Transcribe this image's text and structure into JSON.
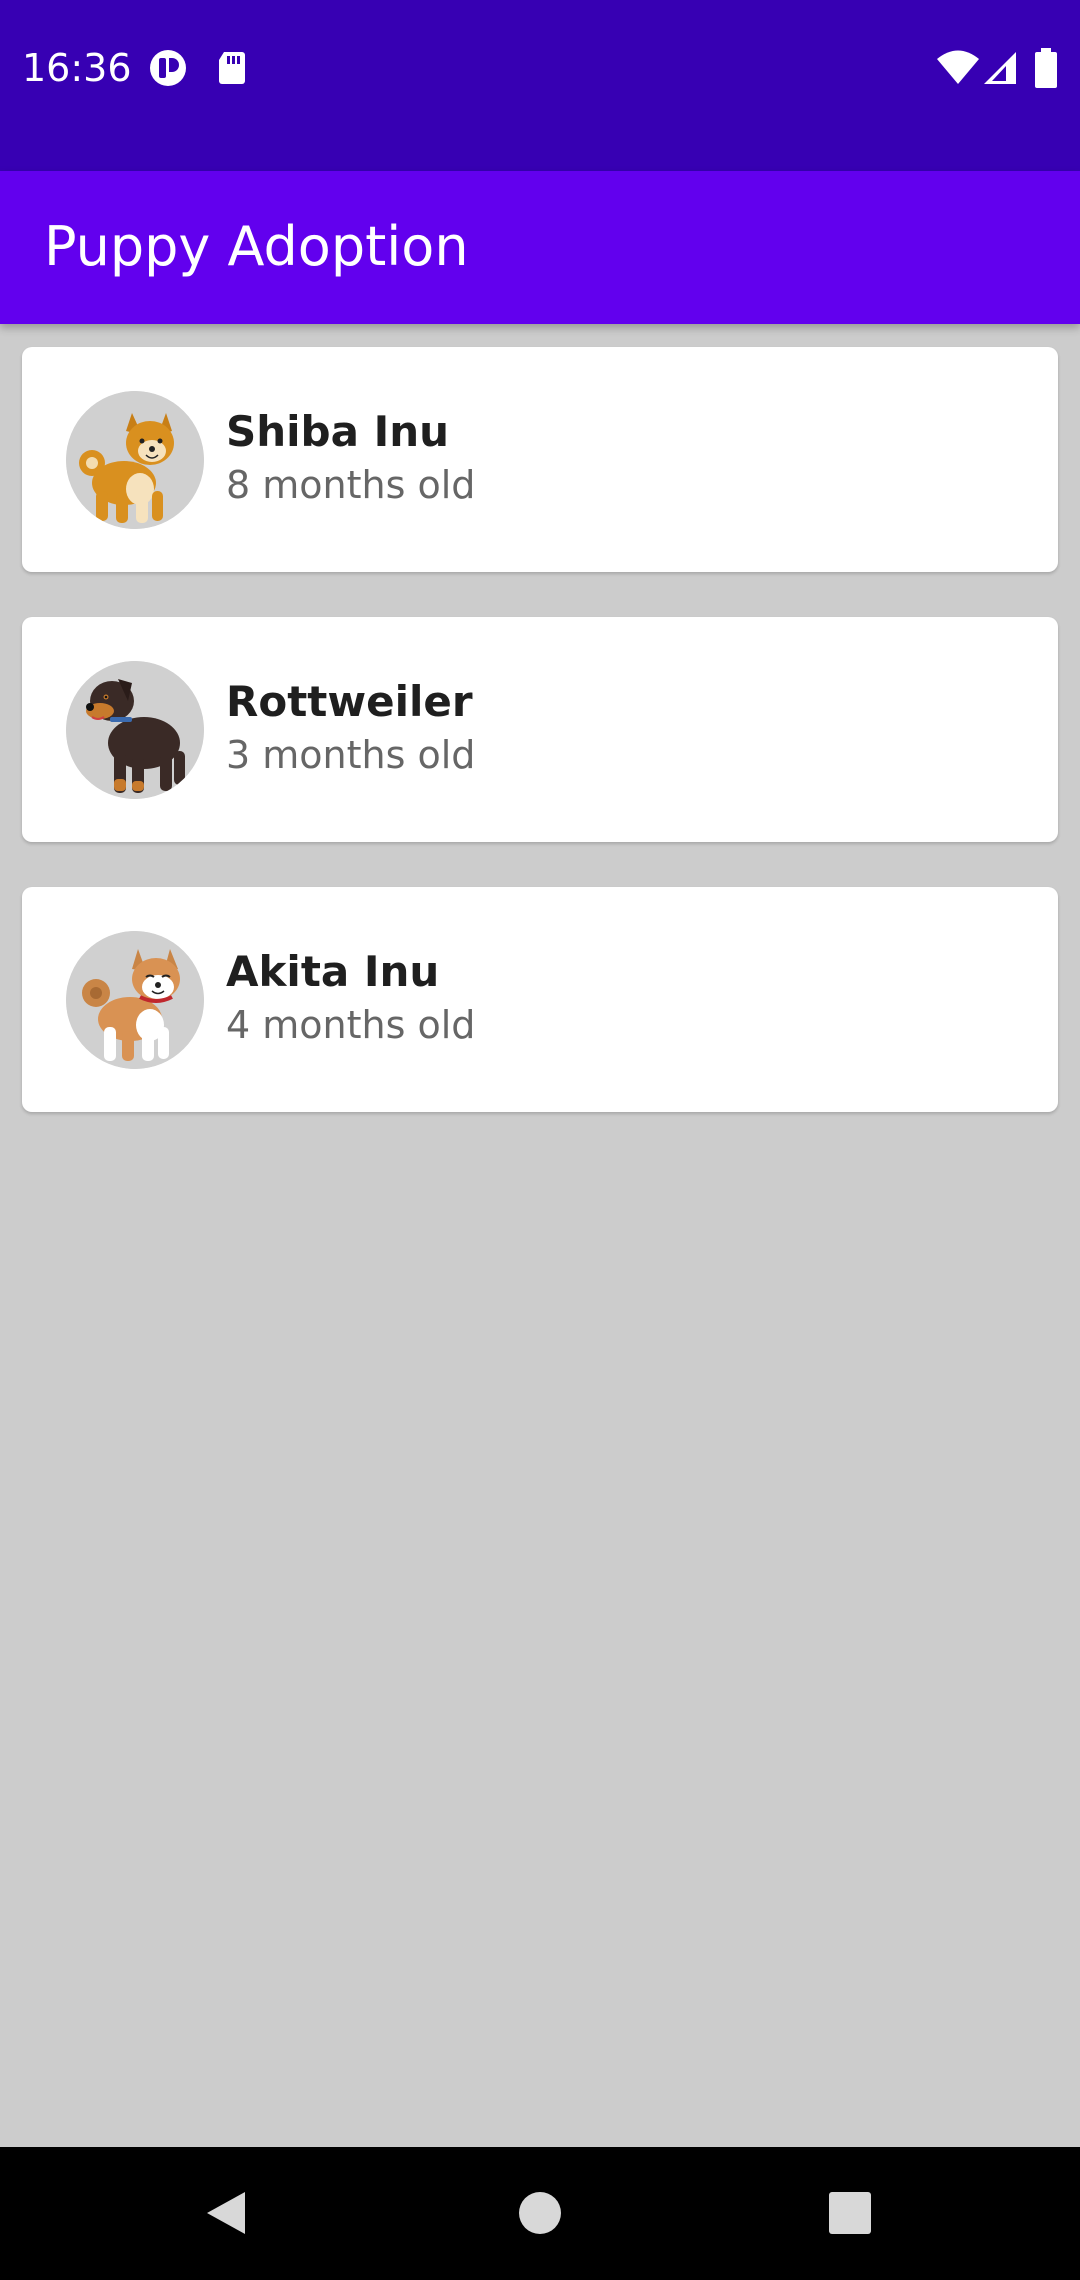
{
  "status_bar": {
    "time": "16:36",
    "left_icons": [
      "app-notification-icon",
      "sd-card-icon"
    ],
    "right_icons": [
      "wifi-icon",
      "cell-signal-icon",
      "battery-icon"
    ],
    "background": "#3700b3"
  },
  "app_bar": {
    "title": "Puppy Adoption",
    "background": "#6200ee"
  },
  "puppies": [
    {
      "name": "Shiba Inu",
      "age": "8 months old",
      "icon": "shiba-inu-icon"
    },
    {
      "name": "Rottweiler",
      "age": "3 months old",
      "icon": "rottweiler-icon"
    },
    {
      "name": "Akita Inu",
      "age": "4 months old",
      "icon": "akita-inu-icon"
    }
  ],
  "nav_bar": {
    "buttons": [
      "back-icon",
      "home-icon",
      "recents-icon"
    ]
  },
  "colors": {
    "page_background": "#cccccc",
    "card_background": "#ffffff",
    "name_text": "#1f1f1f",
    "age_text": "#666666"
  }
}
